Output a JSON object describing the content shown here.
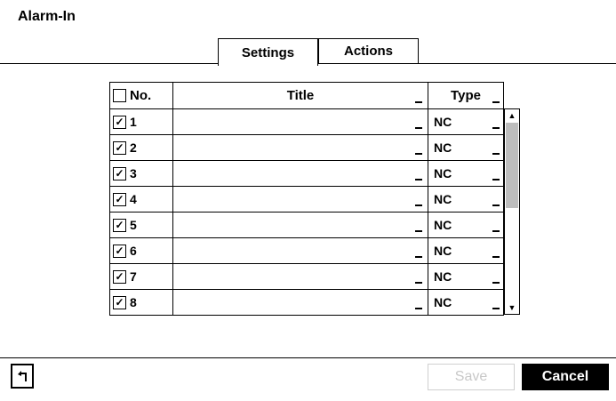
{
  "window": {
    "title": "Alarm-In"
  },
  "tabs": [
    {
      "label": "Settings",
      "active": true
    },
    {
      "label": "Actions",
      "active": false
    }
  ],
  "table": {
    "headers": {
      "no": "No.",
      "title": "Title",
      "type": "Type"
    },
    "rows": [
      {
        "no": "1",
        "checked": true,
        "title": "",
        "type": "NC"
      },
      {
        "no": "2",
        "checked": true,
        "title": "",
        "type": "NC"
      },
      {
        "no": "3",
        "checked": true,
        "title": "",
        "type": "NC"
      },
      {
        "no": "4",
        "checked": true,
        "title": "",
        "type": "NC"
      },
      {
        "no": "5",
        "checked": true,
        "title": "",
        "type": "NC"
      },
      {
        "no": "6",
        "checked": true,
        "title": "",
        "type": "NC"
      },
      {
        "no": "7",
        "checked": true,
        "title": "",
        "type": "NC"
      },
      {
        "no": "8",
        "checked": true,
        "title": "",
        "type": "NC"
      }
    ]
  },
  "buttons": {
    "save": "Save",
    "cancel": "Cancel"
  },
  "icons": {
    "back": "back-arrow-icon",
    "check": "✓",
    "scroll_up": "▲",
    "scroll_down": "▼"
  },
  "colors": {
    "disabled_text": "#c8c8c8",
    "scroll_thumb": "#bdbdbd",
    "cancel_bg": "#000000"
  }
}
